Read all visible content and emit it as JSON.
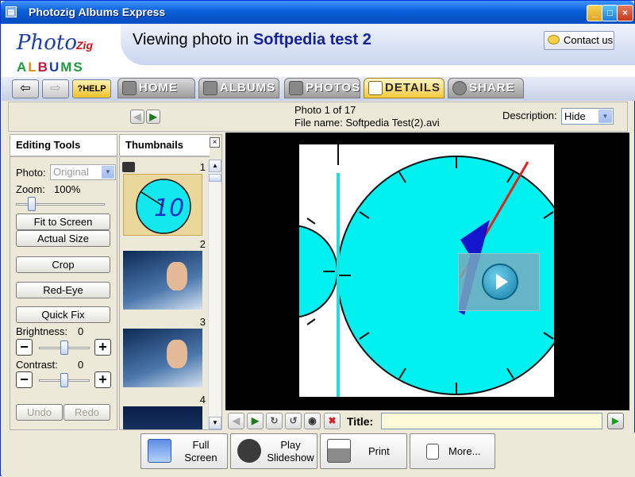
{
  "window": {
    "title": "Photozig Albums Express",
    "minimize": "_",
    "maximize": "□",
    "close": "×"
  },
  "logo": {
    "line1": "Photo",
    "line2": "Zig",
    "line3": [
      "A",
      "L",
      "B",
      "U",
      "M",
      "S"
    ]
  },
  "header": {
    "viewing_prefix": "Viewing photo in",
    "album_name": "Softpedia test 2",
    "contact_label": "Contact us"
  },
  "nav": {
    "back": "⇦",
    "forward": "⇨",
    "help": "?HELP",
    "tabs": [
      {
        "label": "HOME"
      },
      {
        "label": "ALBUMS"
      },
      {
        "label": "PHOTOS"
      },
      {
        "label": "DETAILS"
      },
      {
        "label": "SHARE"
      }
    ]
  },
  "info": {
    "photo_counter": "Photo 1 of 17",
    "file_name_label": "File name:",
    "file_name": "Softpedia Test(2).avi",
    "description_label": "Description:",
    "description_value": "Hide"
  },
  "editing": {
    "title": "Editing Tools",
    "photo_label": "Photo:",
    "photo_value": "Original",
    "zoom_label": "Zoom:",
    "zoom_value": "100%",
    "zoom_level": 0.15,
    "fit_to_screen": "Fit to Screen",
    "actual_size": "Actual Size",
    "crop": "Crop",
    "red_eye": "Red-Eye",
    "quick_fix": "Quick Fix",
    "brightness_label": "Brightness:",
    "brightness_value": "0",
    "contrast_label": "Contrast:",
    "contrast_value": "0",
    "minus": "−",
    "plus": "+",
    "undo": "Undo",
    "redo": "Redo"
  },
  "thumbnails": {
    "title": "Thumbnails",
    "close": "×",
    "items": [
      {
        "num": "1",
        "caption": "10"
      },
      {
        "num": "2"
      },
      {
        "num": "3"
      },
      {
        "num": "4"
      }
    ]
  },
  "viewer": {
    "title_label": "Title:",
    "title_value": ""
  },
  "bottom": {
    "full_screen": [
      "Full",
      "Screen"
    ],
    "play_slideshow": [
      "Play",
      "Slideshow"
    ],
    "print": "Print",
    "more": "More..."
  },
  "colors": {
    "accent": "#16239c",
    "cyan": "#00f0f0",
    "active_tab": "#f6c93d"
  }
}
